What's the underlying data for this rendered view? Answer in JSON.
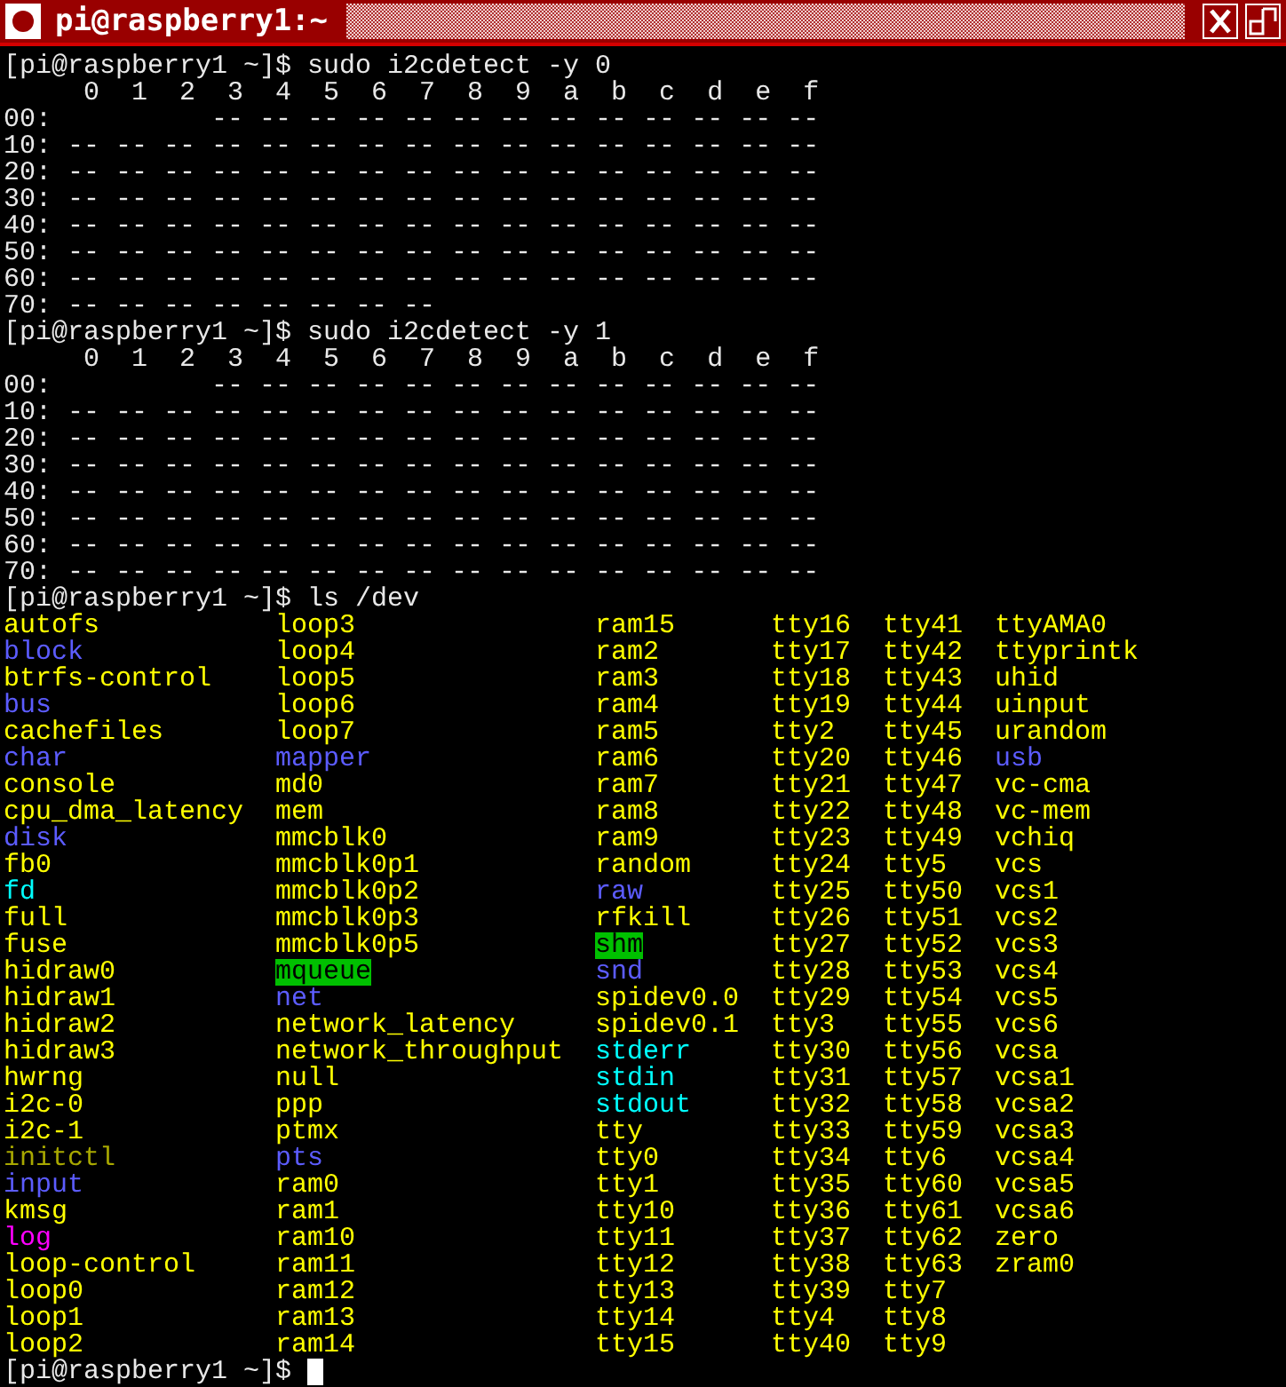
{
  "window": {
    "title": "pi@raspberry1:~"
  },
  "terminal": [
    {
      "kind": "command",
      "text": "[pi@raspberry1 ~]$ sudo i2cdetect -y 0"
    },
    {
      "kind": "output",
      "text": "     0  1  2  3  4  5  6  7  8  9  a  b  c  d  e  f"
    },
    {
      "kind": "output",
      "text": "00:          -- -- -- -- -- -- -- -- -- -- -- -- --"
    },
    {
      "kind": "output",
      "text": "10: -- -- -- -- -- -- -- -- -- -- -- -- -- -- -- --"
    },
    {
      "kind": "output",
      "text": "20: -- -- -- -- -- -- -- -- -- -- -- -- -- -- -- --"
    },
    {
      "kind": "output",
      "text": "30: -- -- -- -- -- -- -- -- -- -- -- -- -- -- -- --"
    },
    {
      "kind": "output",
      "text": "40: -- -- -- -- -- -- -- -- -- -- -- -- -- -- -- --"
    },
    {
      "kind": "output",
      "text": "50: -- -- -- -- -- -- -- -- -- -- -- -- -- -- -- --"
    },
    {
      "kind": "output",
      "text": "60: -- -- -- -- -- -- -- -- -- -- -- -- -- -- -- --"
    },
    {
      "kind": "output",
      "text": "70: -- -- -- -- -- -- -- --"
    },
    {
      "kind": "command",
      "text": "[pi@raspberry1 ~]$ sudo i2cdetect -y 1"
    },
    {
      "kind": "output",
      "text": "     0  1  2  3  4  5  6  7  8  9  a  b  c  d  e  f"
    },
    {
      "kind": "output",
      "text": "00:          -- -- -- -- -- -- -- -- -- -- -- -- --"
    },
    {
      "kind": "output",
      "text": "10: -- -- -- -- -- -- -- -- -- -- -- -- -- -- -- --"
    },
    {
      "kind": "output",
      "text": "20: -- -- -- -- -- -- -- -- -- -- -- -- -- -- -- --"
    },
    {
      "kind": "output",
      "text": "30: -- -- -- -- -- -- -- -- -- -- -- -- -- -- -- --"
    },
    {
      "kind": "output",
      "text": "40: -- -- -- -- -- -- -- -- -- -- -- -- -- -- -- --"
    },
    {
      "kind": "output",
      "text": "50: -- -- -- -- -- -- -- -- -- -- -- -- -- -- -- --"
    },
    {
      "kind": "output",
      "text": "60: -- -- -- -- -- -- -- -- -- -- -- -- -- -- -- --"
    },
    {
      "kind": "output",
      "text": "70: -- -- -- -- -- -- -- -- -- -- -- -- -- -- -- --"
    },
    {
      "kind": "command",
      "text": "[pi@raspberry1 ~]$ ls /dev"
    },
    {
      "kind": "listing",
      "columns": [
        [
          {
            "name": "autofs",
            "kind": "device"
          },
          {
            "name": "block",
            "kind": "directory"
          },
          {
            "name": "btrfs-control",
            "kind": "device"
          },
          {
            "name": "bus",
            "kind": "directory"
          },
          {
            "name": "cachefiles",
            "kind": "device"
          },
          {
            "name": "char",
            "kind": "directory"
          },
          {
            "name": "console",
            "kind": "device"
          },
          {
            "name": "cpu_dma_latency",
            "kind": "device"
          },
          {
            "name": "disk",
            "kind": "directory"
          },
          {
            "name": "fb0",
            "kind": "device"
          },
          {
            "name": "fd",
            "kind": "symlink"
          },
          {
            "name": "full",
            "kind": "device"
          },
          {
            "name": "fuse",
            "kind": "device"
          },
          {
            "name": "hidraw0",
            "kind": "device"
          },
          {
            "name": "hidraw1",
            "kind": "device"
          },
          {
            "name": "hidraw2",
            "kind": "device"
          },
          {
            "name": "hidraw3",
            "kind": "device"
          },
          {
            "name": "hwrng",
            "kind": "device"
          },
          {
            "name": "i2c-0",
            "kind": "device"
          },
          {
            "name": "i2c-1",
            "kind": "device"
          },
          {
            "name": "initctl",
            "kind": "pipe"
          },
          {
            "name": "input",
            "kind": "directory"
          },
          {
            "name": "kmsg",
            "kind": "device"
          },
          {
            "name": "log",
            "kind": "socket"
          },
          {
            "name": "loop-control",
            "kind": "device"
          },
          {
            "name": "loop0",
            "kind": "device"
          },
          {
            "name": "loop1",
            "kind": "device"
          },
          {
            "name": "loop2",
            "kind": "device"
          }
        ],
        [
          {
            "name": "loop3",
            "kind": "device"
          },
          {
            "name": "loop4",
            "kind": "device"
          },
          {
            "name": "loop5",
            "kind": "device"
          },
          {
            "name": "loop6",
            "kind": "device"
          },
          {
            "name": "loop7",
            "kind": "device"
          },
          {
            "name": "mapper",
            "kind": "directory"
          },
          {
            "name": "md0",
            "kind": "device"
          },
          {
            "name": "mem",
            "kind": "device"
          },
          {
            "name": "mmcblk0",
            "kind": "device"
          },
          {
            "name": "mmcblk0p1",
            "kind": "device"
          },
          {
            "name": "mmcblk0p2",
            "kind": "device"
          },
          {
            "name": "mmcblk0p3",
            "kind": "device"
          },
          {
            "name": "mmcblk0p5",
            "kind": "device"
          },
          {
            "name": "mqueue",
            "kind": "sticky"
          },
          {
            "name": "net",
            "kind": "directory"
          },
          {
            "name": "network_latency",
            "kind": "device"
          },
          {
            "name": "network_throughput",
            "kind": "device"
          },
          {
            "name": "null",
            "kind": "device"
          },
          {
            "name": "ppp",
            "kind": "device"
          },
          {
            "name": "ptmx",
            "kind": "device"
          },
          {
            "name": "pts",
            "kind": "directory"
          },
          {
            "name": "ram0",
            "kind": "device"
          },
          {
            "name": "ram1",
            "kind": "device"
          },
          {
            "name": "ram10",
            "kind": "device"
          },
          {
            "name": "ram11",
            "kind": "device"
          },
          {
            "name": "ram12",
            "kind": "device"
          },
          {
            "name": "ram13",
            "kind": "device"
          },
          {
            "name": "ram14",
            "kind": "device"
          }
        ],
        [
          {
            "name": "ram15",
            "kind": "device"
          },
          {
            "name": "ram2",
            "kind": "device"
          },
          {
            "name": "ram3",
            "kind": "device"
          },
          {
            "name": "ram4",
            "kind": "device"
          },
          {
            "name": "ram5",
            "kind": "device"
          },
          {
            "name": "ram6",
            "kind": "device"
          },
          {
            "name": "ram7",
            "kind": "device"
          },
          {
            "name": "ram8",
            "kind": "device"
          },
          {
            "name": "ram9",
            "kind": "device"
          },
          {
            "name": "random",
            "kind": "device"
          },
          {
            "name": "raw",
            "kind": "directory"
          },
          {
            "name": "rfkill",
            "kind": "device"
          },
          {
            "name": "shm",
            "kind": "sticky"
          },
          {
            "name": "snd",
            "kind": "directory"
          },
          {
            "name": "spidev0.0",
            "kind": "device"
          },
          {
            "name": "spidev0.1",
            "kind": "device"
          },
          {
            "name": "stderr",
            "kind": "symlink"
          },
          {
            "name": "stdin",
            "kind": "symlink"
          },
          {
            "name": "stdout",
            "kind": "symlink"
          },
          {
            "name": "tty",
            "kind": "device"
          },
          {
            "name": "tty0",
            "kind": "device"
          },
          {
            "name": "tty1",
            "kind": "device"
          },
          {
            "name": "tty10",
            "kind": "device"
          },
          {
            "name": "tty11",
            "kind": "device"
          },
          {
            "name": "tty12",
            "kind": "device"
          },
          {
            "name": "tty13",
            "kind": "device"
          },
          {
            "name": "tty14",
            "kind": "device"
          },
          {
            "name": "tty15",
            "kind": "device"
          }
        ],
        [
          {
            "name": "tty16",
            "kind": "device"
          },
          {
            "name": "tty17",
            "kind": "device"
          },
          {
            "name": "tty18",
            "kind": "device"
          },
          {
            "name": "tty19",
            "kind": "device"
          },
          {
            "name": "tty2",
            "kind": "device"
          },
          {
            "name": "tty20",
            "kind": "device"
          },
          {
            "name": "tty21",
            "kind": "device"
          },
          {
            "name": "tty22",
            "kind": "device"
          },
          {
            "name": "tty23",
            "kind": "device"
          },
          {
            "name": "tty24",
            "kind": "device"
          },
          {
            "name": "tty25",
            "kind": "device"
          },
          {
            "name": "tty26",
            "kind": "device"
          },
          {
            "name": "tty27",
            "kind": "device"
          },
          {
            "name": "tty28",
            "kind": "device"
          },
          {
            "name": "tty29",
            "kind": "device"
          },
          {
            "name": "tty3",
            "kind": "device"
          },
          {
            "name": "tty30",
            "kind": "device"
          },
          {
            "name": "tty31",
            "kind": "device"
          },
          {
            "name": "tty32",
            "kind": "device"
          },
          {
            "name": "tty33",
            "kind": "device"
          },
          {
            "name": "tty34",
            "kind": "device"
          },
          {
            "name": "tty35",
            "kind": "device"
          },
          {
            "name": "tty36",
            "kind": "device"
          },
          {
            "name": "tty37",
            "kind": "device"
          },
          {
            "name": "tty38",
            "kind": "device"
          },
          {
            "name": "tty39",
            "kind": "device"
          },
          {
            "name": "tty4",
            "kind": "device"
          },
          {
            "name": "tty40",
            "kind": "device"
          }
        ],
        [
          {
            "name": "tty41",
            "kind": "device"
          },
          {
            "name": "tty42",
            "kind": "device"
          },
          {
            "name": "tty43",
            "kind": "device"
          },
          {
            "name": "tty44",
            "kind": "device"
          },
          {
            "name": "tty45",
            "kind": "device"
          },
          {
            "name": "tty46",
            "kind": "device"
          },
          {
            "name": "tty47",
            "kind": "device"
          },
          {
            "name": "tty48",
            "kind": "device"
          },
          {
            "name": "tty49",
            "kind": "device"
          },
          {
            "name": "tty5",
            "kind": "device"
          },
          {
            "name": "tty50",
            "kind": "device"
          },
          {
            "name": "tty51",
            "kind": "device"
          },
          {
            "name": "tty52",
            "kind": "device"
          },
          {
            "name": "tty53",
            "kind": "device"
          },
          {
            "name": "tty54",
            "kind": "device"
          },
          {
            "name": "tty55",
            "kind": "device"
          },
          {
            "name": "tty56",
            "kind": "device"
          },
          {
            "name": "tty57",
            "kind": "device"
          },
          {
            "name": "tty58",
            "kind": "device"
          },
          {
            "name": "tty59",
            "kind": "device"
          },
          {
            "name": "tty6",
            "kind": "device"
          },
          {
            "name": "tty60",
            "kind": "device"
          },
          {
            "name": "tty61",
            "kind": "device"
          },
          {
            "name": "tty62",
            "kind": "device"
          },
          {
            "name": "tty63",
            "kind": "device"
          },
          {
            "name": "tty7",
            "kind": "device"
          },
          {
            "name": "tty8",
            "kind": "device"
          },
          {
            "name": "tty9",
            "kind": "device"
          }
        ],
        [
          {
            "name": "ttyAMA0",
            "kind": "device"
          },
          {
            "name": "ttyprintk",
            "kind": "device"
          },
          {
            "name": "uhid",
            "kind": "device"
          },
          {
            "name": "uinput",
            "kind": "device"
          },
          {
            "name": "urandom",
            "kind": "device"
          },
          {
            "name": "usb",
            "kind": "directory"
          },
          {
            "name": "vc-cma",
            "kind": "device"
          },
          {
            "name": "vc-mem",
            "kind": "device"
          },
          {
            "name": "vchiq",
            "kind": "device"
          },
          {
            "name": "vcs",
            "kind": "device"
          },
          {
            "name": "vcs1",
            "kind": "device"
          },
          {
            "name": "vcs2",
            "kind": "device"
          },
          {
            "name": "vcs3",
            "kind": "device"
          },
          {
            "name": "vcs4",
            "kind": "device"
          },
          {
            "name": "vcs5",
            "kind": "device"
          },
          {
            "name": "vcs6",
            "kind": "device"
          },
          {
            "name": "vcsa",
            "kind": "device"
          },
          {
            "name": "vcsa1",
            "kind": "device"
          },
          {
            "name": "vcsa2",
            "kind": "device"
          },
          {
            "name": "vcsa3",
            "kind": "device"
          },
          {
            "name": "vcsa4",
            "kind": "device"
          },
          {
            "name": "vcsa5",
            "kind": "device"
          },
          {
            "name": "vcsa6",
            "kind": "device"
          },
          {
            "name": "zero",
            "kind": "device"
          },
          {
            "name": "zram0",
            "kind": "device"
          }
        ]
      ]
    },
    {
      "kind": "prompt",
      "text": "[pi@raspberry1 ~]$",
      "cursor": true
    }
  ]
}
